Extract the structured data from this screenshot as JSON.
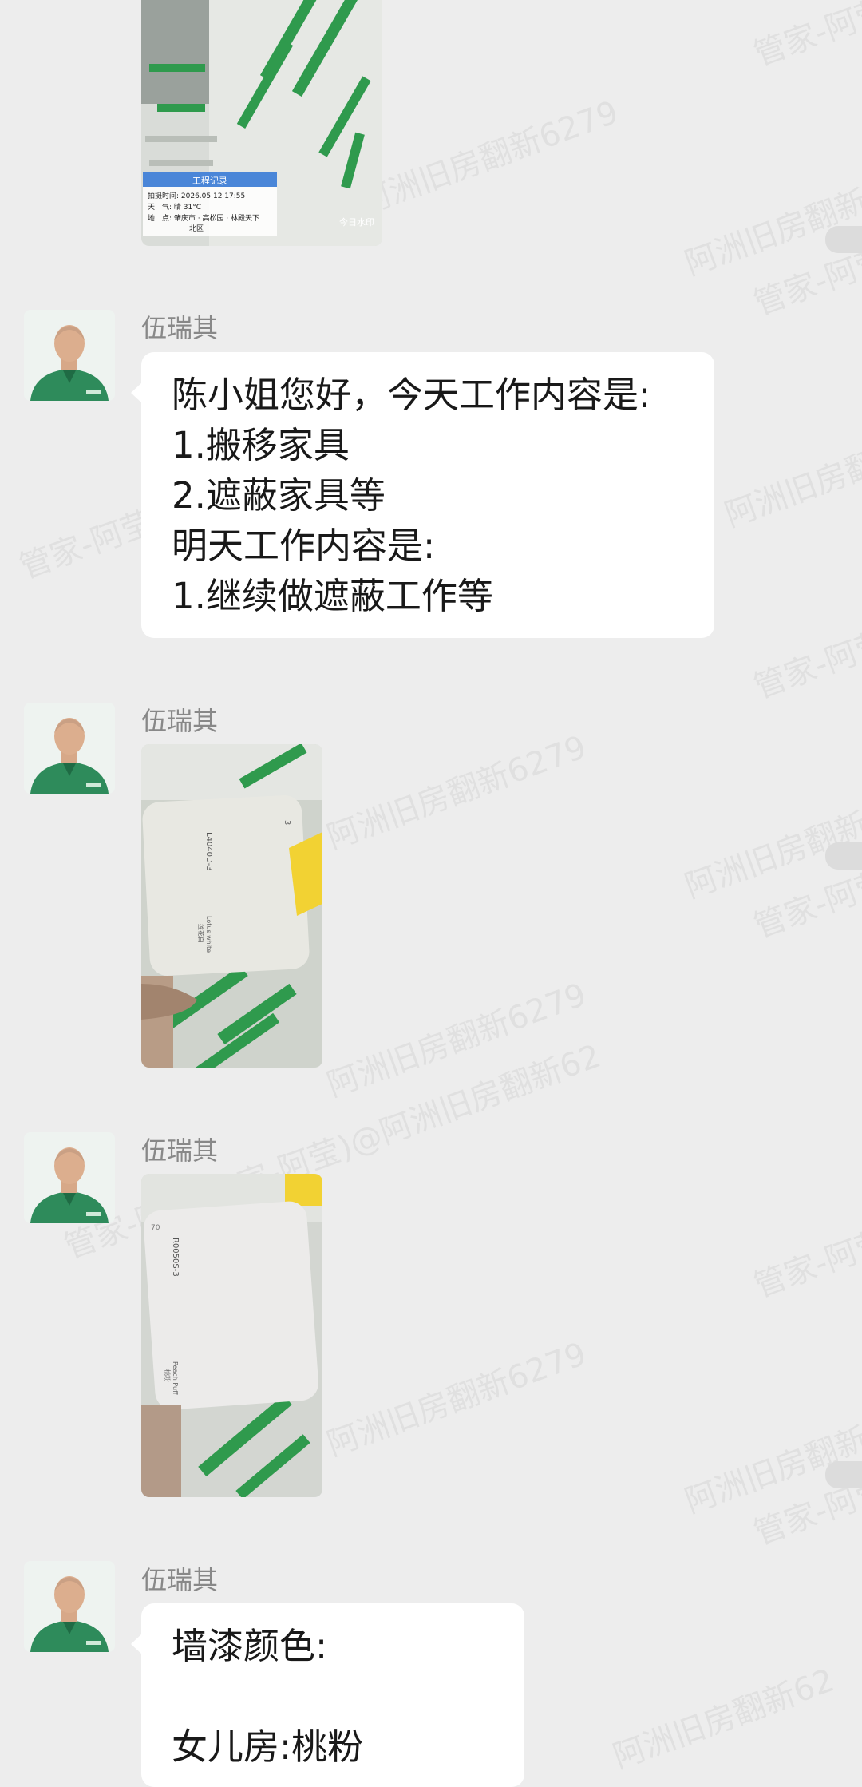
{
  "watermarks": [
    "阿洲旧房翻新6279",
    "管家-阿莹",
    "阿洲旧房翻新6279",
    "管家-阿莹",
    "阿洲旧房翻新62",
    "管家-阿莹",
    "阿洲旧房翻新6279",
    "阿洲旧房翻新62",
    "管家-阿莹",
    "阿洲旧房翻新6279",
    "管家-阿莹(管家-阿莹)@阿洲旧房翻新62",
    "管家-阿莹",
    "阿洲旧房翻新6279",
    "阿洲旧房翻新62",
    "管家-阿莹",
    "阿洲旧房翻新62"
  ],
  "photo_overlay": {
    "title": "工程记录",
    "time_line": "拍摄时间: 2026.05.12 17:55",
    "weather_line": "天　气: 晴 31°C",
    "location_line": "地　点: 肇庆市 · 高松园 · 林殿天下",
    "location_line2": "北区",
    "watermark_app": "今日水印"
  },
  "messages": [
    {
      "sender": "伍瑞其",
      "lines": [
        "陈小姐您好，今天工作内容是:",
        "1.搬移家具",
        "2.遮蔽家具等",
        "明天工作内容是:",
        "1.继续做遮蔽工作等"
      ]
    },
    {
      "sender": "伍瑞其",
      "photo_text": [
        "L4040D-3",
        "Lotus white",
        "莲花白",
        "3"
      ]
    },
    {
      "sender": "伍瑞其",
      "photo_text": [
        "R0050S-3",
        "Peach Puff",
        "桃粉",
        "70"
      ]
    },
    {
      "sender": "伍瑞其",
      "lines": [
        "墙漆颜色:",
        "",
        "女儿房:桃粉"
      ]
    }
  ]
}
